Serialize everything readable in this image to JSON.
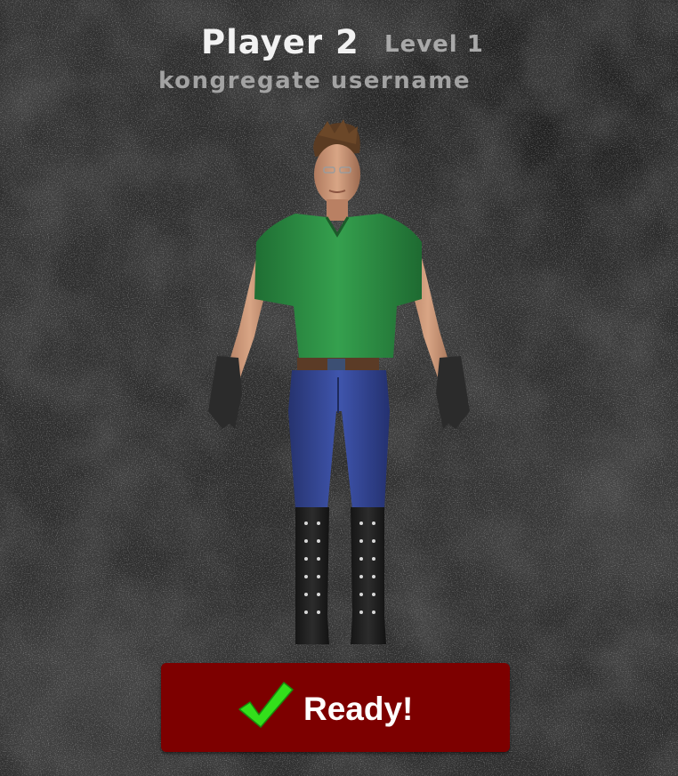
{
  "player": {
    "name": "Player 2",
    "level": "Level 1",
    "username": "kongregate username"
  },
  "ready_button": {
    "label": "Ready!",
    "icon": "checkmark-icon",
    "background_color": "#7d0000",
    "icon_color": "#33e01b"
  },
  "character": {
    "shirt_color": "#2e8f45",
    "pants_color": "#34489e",
    "accessories": [
      "black-gloves",
      "studded-knee-boots"
    ]
  }
}
